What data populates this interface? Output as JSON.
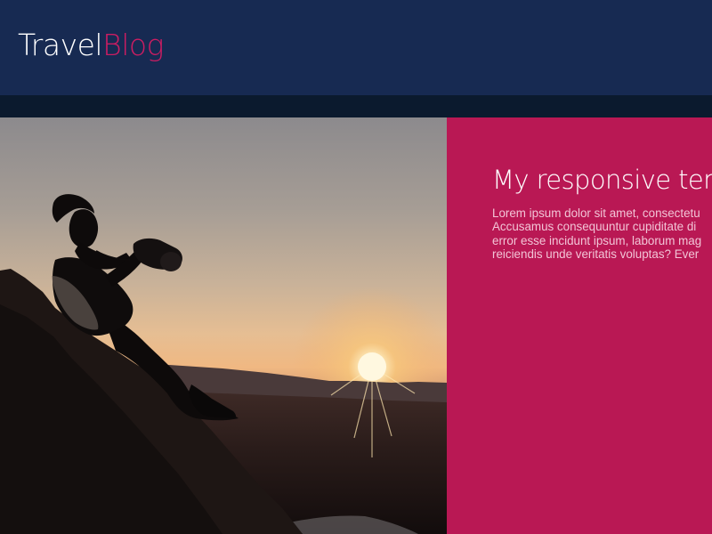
{
  "header": {
    "logo_part1": "Travel",
    "logo_part2": "Blog",
    "logo_accent_color": "#cc1d62"
  },
  "hero": {
    "image_alt": "Silhouette of a woman photographing a sunset from a hillside"
  },
  "feature": {
    "title": "My responsive tem",
    "text_lines": [
      "Lorem ipsum dolor sit amet, consectetu",
      "Accusamus consequuntur cupiditate di",
      "error esse incidunt ipsum, laborum mag",
      "reiciendis unde veritatis voluptas? Ever"
    ],
    "background_color": "#b91854"
  },
  "colors": {
    "header_bg": "#172a52",
    "nav_strip_bg": "#0b1a2e"
  }
}
